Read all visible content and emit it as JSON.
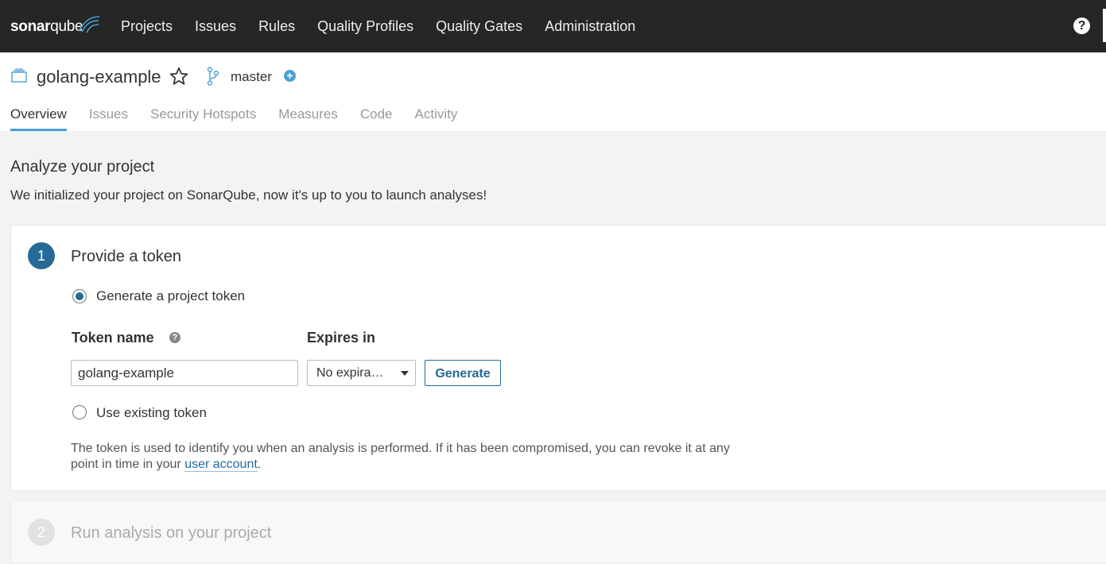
{
  "brand": {
    "logo_bold": "sonar",
    "logo_light": "qube"
  },
  "nav": {
    "items": [
      {
        "label": "Projects"
      },
      {
        "label": "Issues"
      },
      {
        "label": "Rules"
      },
      {
        "label": "Quality Profiles"
      },
      {
        "label": "Quality Gates"
      },
      {
        "label": "Administration"
      }
    ],
    "help_icon": "?"
  },
  "project": {
    "name": "golang-example",
    "branch": "master",
    "add_branch_icon": "+"
  },
  "tabs": [
    {
      "label": "Overview",
      "active": true
    },
    {
      "label": "Issues"
    },
    {
      "label": "Security Hotspots"
    },
    {
      "label": "Measures"
    },
    {
      "label": "Code"
    },
    {
      "label": "Activity"
    }
  ],
  "main": {
    "title": "Analyze your project",
    "subtitle": "We initialized your project on SonarQube, now it's up to you to launch analyses!"
  },
  "step1": {
    "number": "1",
    "title": "Provide a token",
    "option_generate": "Generate a project token",
    "token_name_label": "Token name",
    "token_help_icon": "?",
    "expires_label": "Expires in",
    "token_name_value": "golang-example",
    "expires_value": "No expira…",
    "generate_button": "Generate",
    "option_existing": "Use existing token",
    "help_text": "The token is used to identify you when an analysis is performed. If it has been compromised, you can revoke it at any point in time in your",
    "help_link": "user account",
    "help_end": "."
  },
  "step2": {
    "number": "2",
    "title": "Run analysis on your project"
  },
  "colors": {
    "nav_bg": "#262626",
    "accent": "#4b9fd5",
    "primary": "#236a97"
  }
}
